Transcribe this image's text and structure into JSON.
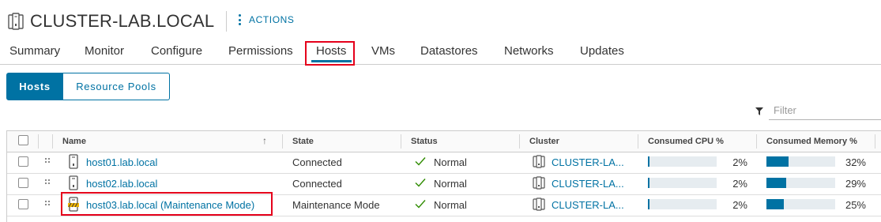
{
  "header": {
    "title": "CLUSTER-LAB.LOCAL",
    "icon": "cluster-icon",
    "actions_label": "ACTIONS"
  },
  "tabs": [
    {
      "label": "Summary",
      "active": false
    },
    {
      "label": "Monitor",
      "active": false
    },
    {
      "label": "Configure",
      "active": false
    },
    {
      "label": "Permissions",
      "active": false
    },
    {
      "label": "Hosts",
      "active": true
    },
    {
      "label": "VMs",
      "active": false
    },
    {
      "label": "Datastores",
      "active": false
    },
    {
      "label": "Networks",
      "active": false
    },
    {
      "label": "Updates",
      "active": false
    }
  ],
  "subtabs": [
    {
      "label": "Hosts",
      "active": true
    },
    {
      "label": "Resource Pools",
      "active": false
    }
  ],
  "filter": {
    "placeholder": "Filter",
    "value": ""
  },
  "table": {
    "columns": [
      "Name",
      "State",
      "Status",
      "Cluster",
      "Consumed CPU %",
      "Consumed Memory %"
    ],
    "sort": {
      "column": "Name",
      "direction": "ascending"
    },
    "rows": [
      {
        "name": "host01.lab.local",
        "state": "Connected",
        "status": "Normal",
        "cluster": "CLUSTER-LA...",
        "cpu_label": "2%",
        "cpu": 2,
        "mem_label": "32%",
        "mem": 32,
        "icon": "host-icon"
      },
      {
        "name": "host02.lab.local",
        "state": "Connected",
        "status": "Normal",
        "cluster": "CLUSTER-LA...",
        "cpu_label": "2%",
        "cpu": 2,
        "mem_label": "29%",
        "mem": 29,
        "icon": "host-icon"
      },
      {
        "name": "host03.lab.local (Maintenance Mode)",
        "state": "Maintenance Mode",
        "status": "Normal",
        "cluster": "CLUSTER-LA...",
        "cpu_label": "2%",
        "cpu": 2,
        "mem_label": "25%",
        "mem": 25,
        "icon": "host-maintenance-icon"
      }
    ]
  },
  "colors": {
    "accent": "#0072a3",
    "highlight": "#e5001b",
    "status_ok": "#2e8b00",
    "maintenance": "#f0b400"
  }
}
